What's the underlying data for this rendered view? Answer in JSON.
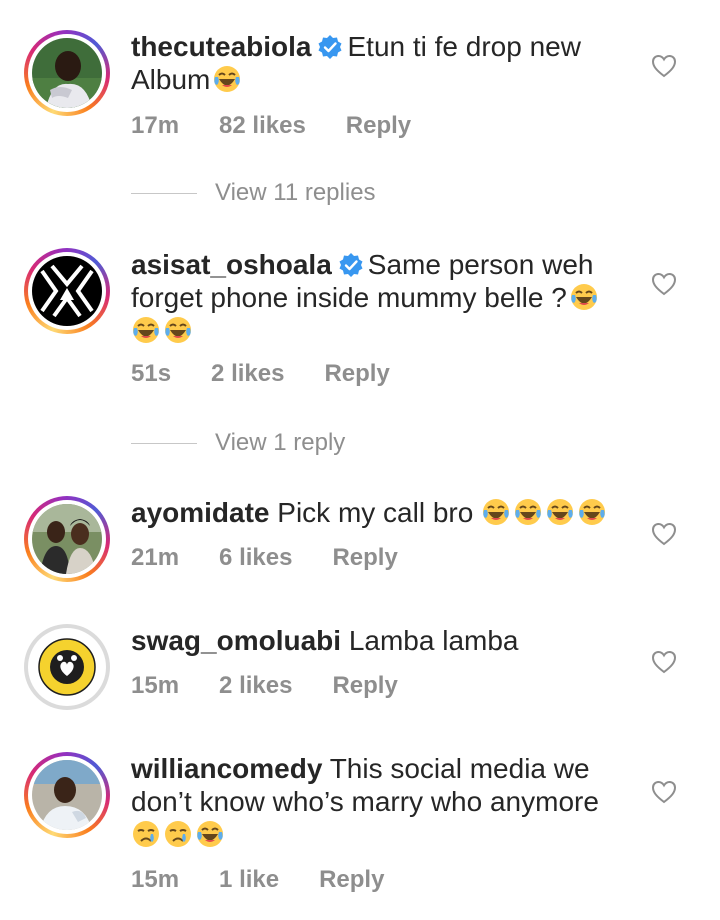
{
  "comments": [
    {
      "username": "thecuteabiola",
      "verified": true,
      "text": "Etun ti fe drop new Album",
      "emojis": [
        "laughing-crying"
      ],
      "time": "17m",
      "likes": "82 likes",
      "reply_label": "Reply",
      "view_replies": "View 11 replies"
    },
    {
      "username": "asisat_oshoala",
      "verified": true,
      "text": "Same person weh forget phone inside mummy belle ?",
      "emojis": [
        "laughing-crying",
        "laughing-crying",
        "laughing-crying"
      ],
      "time": "51s",
      "likes": "2 likes",
      "reply_label": "Reply",
      "view_replies": "View 1 reply"
    },
    {
      "username": "ayomidate",
      "verified": false,
      "text": "Pick my call bro",
      "emojis": [
        "laughing-crying",
        "laughing-crying",
        "laughing-crying",
        "laughing-crying"
      ],
      "time": "21m",
      "likes": "6 likes",
      "reply_label": "Reply"
    },
    {
      "username": "swag_omoluabi",
      "verified": false,
      "text": "Lamba lamba",
      "emojis": [],
      "time": "15m",
      "likes": "2 likes",
      "reply_label": "Reply"
    },
    {
      "username": "williancomedy",
      "verified": false,
      "text": "This social media we don’t know who’s marry who anymore",
      "emojis": [
        "crying",
        "crying",
        "laughing-crying"
      ],
      "time": "15m",
      "likes": "1 like",
      "reply_label": "Reply"
    }
  ],
  "icons": {
    "like": "heart-outline-icon",
    "verified": "verified-badge-icon"
  },
  "colors": {
    "verified_blue": "#3897f0",
    "meta_gray": "#8e8e8e",
    "text": "#262626"
  }
}
